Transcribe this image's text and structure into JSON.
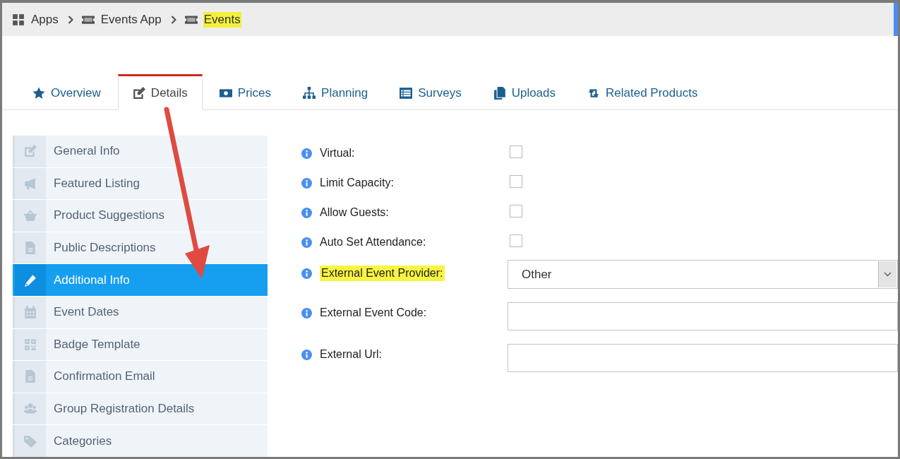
{
  "breadcrumb": [
    {
      "label": "Apps",
      "highlighted": false
    },
    {
      "label": "Events App",
      "highlighted": false
    },
    {
      "label": "Events",
      "highlighted": true
    }
  ],
  "tabs": [
    {
      "label": "Overview",
      "selected": false
    },
    {
      "label": "Details",
      "selected": true
    },
    {
      "label": "Prices",
      "selected": false
    },
    {
      "label": "Planning",
      "selected": false
    },
    {
      "label": "Surveys",
      "selected": false
    },
    {
      "label": "Uploads",
      "selected": false
    },
    {
      "label": "Related Products",
      "selected": false
    }
  ],
  "sidebar": {
    "items": [
      {
        "label": "General Info",
        "selected": false
      },
      {
        "label": "Featured Listing",
        "selected": false
      },
      {
        "label": "Product Suggestions",
        "selected": false
      },
      {
        "label": "Public Descriptions",
        "selected": false
      },
      {
        "label": "Additional Info",
        "selected": true
      },
      {
        "label": "Event Dates",
        "selected": false
      },
      {
        "label": "Badge Template",
        "selected": false
      },
      {
        "label": "Confirmation Email",
        "selected": false
      },
      {
        "label": "Group Registration Details",
        "selected": false
      },
      {
        "label": "Categories",
        "selected": false
      }
    ]
  },
  "form": {
    "fields": [
      {
        "kind": "checkbox",
        "label": "Virtual:",
        "checked": false,
        "highlighted": false
      },
      {
        "kind": "checkbox",
        "label": "Limit Capacity:",
        "checked": false,
        "highlighted": false
      },
      {
        "kind": "checkbox",
        "label": "Allow Guests:",
        "checked": false,
        "highlighted": false
      },
      {
        "kind": "checkbox",
        "label": "Auto Set Attendance:",
        "checked": false,
        "highlighted": false
      },
      {
        "kind": "select",
        "label": "External Event Provider:",
        "value": "Other",
        "highlighted": true
      },
      {
        "kind": "text",
        "label": "External Event Code:",
        "highlighted": false
      },
      {
        "kind": "text",
        "label": "External Url:",
        "highlighted": false
      }
    ]
  }
}
